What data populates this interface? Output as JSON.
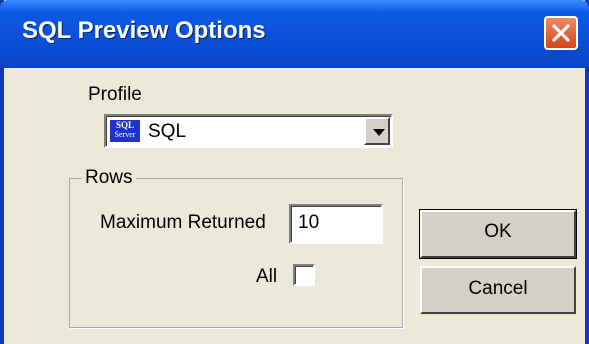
{
  "window": {
    "title": "SQL Preview Options"
  },
  "profile": {
    "label": "Profile",
    "selected": "SQL",
    "icon_text_top": "SQL",
    "icon_text_bottom": "Server"
  },
  "rows": {
    "group_label": "Rows",
    "max_returned_label": "Maximum Returned",
    "max_returned_value": "10",
    "all_label": "All",
    "all_checked": false
  },
  "buttons": {
    "ok": "OK",
    "cancel": "Cancel"
  },
  "icons": {
    "close": "close-icon",
    "dropdown": "chevron-down-icon",
    "profile": "sql-server-icon"
  },
  "colors": {
    "titlebar": "#0a4fd6",
    "close": "#d5431b",
    "dialog_bg": "#ece9d8"
  }
}
